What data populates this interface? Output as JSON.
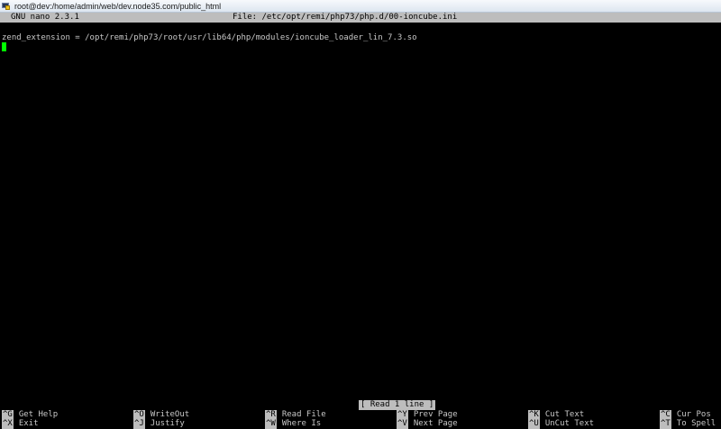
{
  "window": {
    "title": "root@dev:/home/admin/web/dev.node35.com/public_html",
    "icon": "putty-icon"
  },
  "nano": {
    "version": "GNU nano 2.3.1",
    "file_label": "File: /etc/opt/remi/php73/php.d/00-ioncube.ini"
  },
  "content": {
    "lines": [
      "zend_extension = /opt/remi/php73/root/usr/lib64/php/modules/ioncube_loader_lin_7.3.so"
    ]
  },
  "status": "[ Read 1 line ]",
  "shortcuts": {
    "row1": [
      {
        "key": "^G",
        "label": "Get Help"
      },
      {
        "key": "^O",
        "label": "WriteOut"
      },
      {
        "key": "^R",
        "label": "Read File"
      },
      {
        "key": "^Y",
        "label": "Prev Page"
      },
      {
        "key": "^K",
        "label": "Cut Text"
      },
      {
        "key": "^C",
        "label": "Cur Pos"
      }
    ],
    "row2": [
      {
        "key": "^X",
        "label": "Exit"
      },
      {
        "key": "^J",
        "label": "Justify"
      },
      {
        "key": "^W",
        "label": "Where Is"
      },
      {
        "key": "^V",
        "label": "Next Page"
      },
      {
        "key": "^U",
        "label": "UnCut Text"
      },
      {
        "key": "^T",
        "label": "To Spell"
      }
    ]
  },
  "colors": {
    "background": "#000000",
    "bar": "#bdbdbd",
    "cursor": "#00ff00",
    "text": "#c8c8c8"
  }
}
